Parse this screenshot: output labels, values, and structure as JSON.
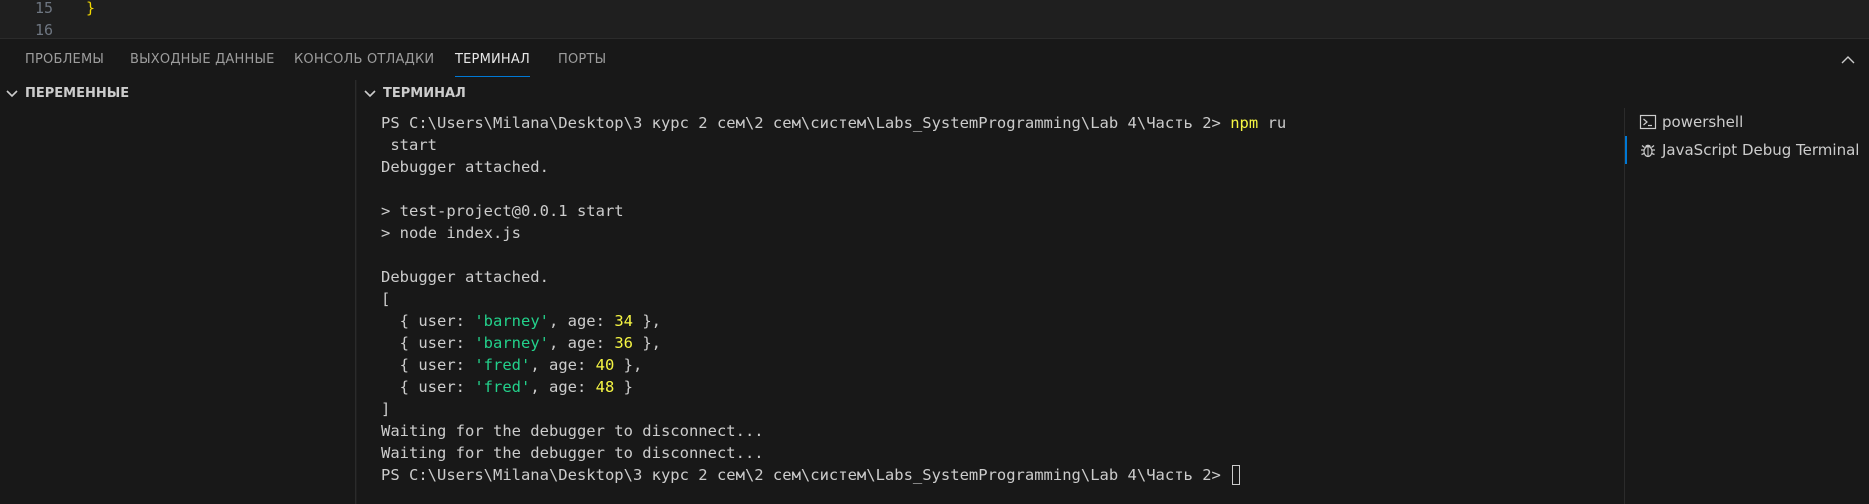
{
  "editor": {
    "lines": [
      {
        "number": "15",
        "code": "}"
      },
      {
        "number": "16",
        "code": ""
      }
    ]
  },
  "panel": {
    "tabs": [
      {
        "label": "ПРОБЛЕМЫ",
        "active": false
      },
      {
        "label": "ВЫХОДНЫЕ ДАННЫЕ",
        "active": false
      },
      {
        "label": "КОНСОЛЬ ОТЛАДКИ",
        "active": false
      },
      {
        "label": "ТЕРМИНАЛ",
        "active": true
      },
      {
        "label": "ПОРТЫ",
        "active": false
      }
    ],
    "collapse_icon": "chevron-up-icon"
  },
  "variables": {
    "title": "ПЕРЕМЕННЫЕ"
  },
  "terminal": {
    "title": "ТЕРМИНАЛ",
    "prompt": "PS C:\\Users\\Milana\\Desktop\\3 курс 2 сем\\2 сем\\систем\\Labs_SystemProgramming\\Lab 4\\Часть 2>",
    "command_head": "npm",
    "command_tail": "ru",
    "command_wrap": " start",
    "debugger_attached": "Debugger attached.",
    "script_line": "> test-project@0.0.1 start",
    "node_line": "> node index.js",
    "open_bracket": "[",
    "close_bracket": "]",
    "records": [
      {
        "user": "'barney'",
        "age": "34",
        "sep": ","
      },
      {
        "user": "'barney'",
        "age": "36",
        "sep": ","
      },
      {
        "user": "'fred'",
        "age": "40",
        "sep": ","
      },
      {
        "user": "'fred'",
        "age": "48",
        "sep": ""
      }
    ],
    "waiting_line": "Waiting for the debugger to disconnect..."
  },
  "terminal_list": {
    "items": [
      {
        "label": "powershell",
        "icon": "terminal-powershell-icon",
        "selected": false
      },
      {
        "label": "JavaScript Debug Terminal",
        "icon": "debug-bug-icon",
        "selected": true
      }
    ]
  },
  "colors": {
    "background": "#1f1f1f",
    "panel": "#181818",
    "accent": "#0078d4",
    "string": "#23d18b",
    "number": "#f5f543"
  }
}
